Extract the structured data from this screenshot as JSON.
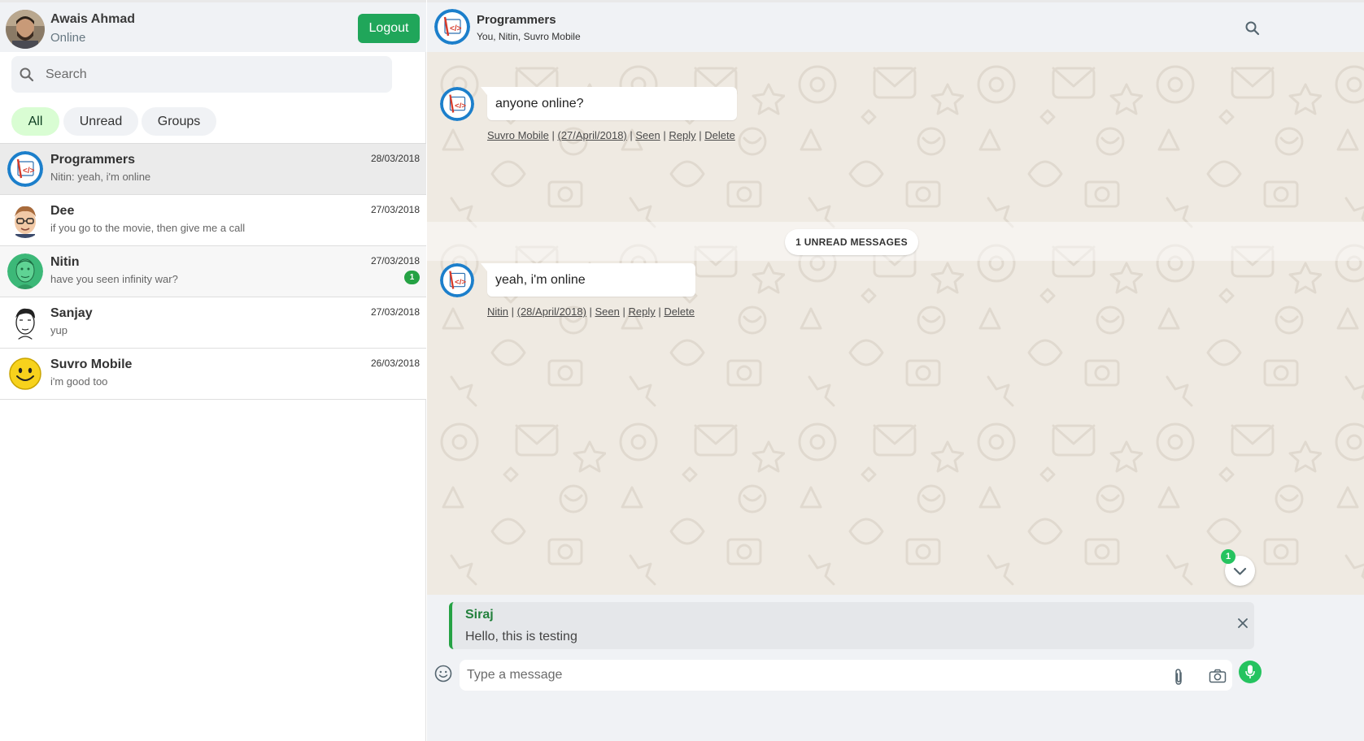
{
  "user": {
    "name": "Awais Ahmad",
    "status": "Online",
    "logout_label": "Logout"
  },
  "search": {
    "placeholder": "Search",
    "icon": "search-icon"
  },
  "filters": [
    {
      "label": "All",
      "active": true
    },
    {
      "label": "Unread",
      "active": false
    },
    {
      "label": "Groups",
      "active": false
    }
  ],
  "chats": [
    {
      "name": "Programmers",
      "preview": "Nitin: yeah, i'm online",
      "date": "28/03/2018",
      "selected": true,
      "avatar": "code-logo-avatar"
    },
    {
      "name": "Dee",
      "preview": "if you go to the movie, then give me a call",
      "date": "27/03/2018",
      "avatar": "cartoon-glasses-avatar"
    },
    {
      "name": "Nitin",
      "preview": "have you seen infinity war?",
      "date": "27/03/2018",
      "unread": "1",
      "avatar": "green-sketch-avatar"
    },
    {
      "name": "Sanjay",
      "preview": "yup",
      "date": "27/03/2018",
      "avatar": "line-drawing-avatar"
    },
    {
      "name": "Suvro Mobile",
      "preview": "i'm good too",
      "date": "26/03/2018",
      "avatar": "smiley-avatar"
    }
  ],
  "conversation": {
    "title": "Programmers",
    "members": "You, Nitin, Suvro Mobile",
    "messages": [
      {
        "text": "anyone online?",
        "author": "Suvro Mobile",
        "date": "(27/April/2018)",
        "seen": "Seen",
        "reply": "Reply",
        "delete": "Delete"
      },
      {
        "text": "yeah, i'm online",
        "author": "Nitin",
        "date": "(28/April/2018)",
        "seen": "Seen",
        "reply": "Reply",
        "delete": "Delete"
      }
    ],
    "unread_divider": "1 UNREAD MESSAGES",
    "scroll_badge": "1"
  },
  "reply_preview": {
    "name": "Siraj",
    "text": "Hello, this is testing"
  },
  "composer": {
    "placeholder": "Type a message"
  },
  "colors": {
    "accent": "#20a65a",
    "chat_background": "#efeae2",
    "panel": "#f0f2f5",
    "badge": "#25a244"
  }
}
